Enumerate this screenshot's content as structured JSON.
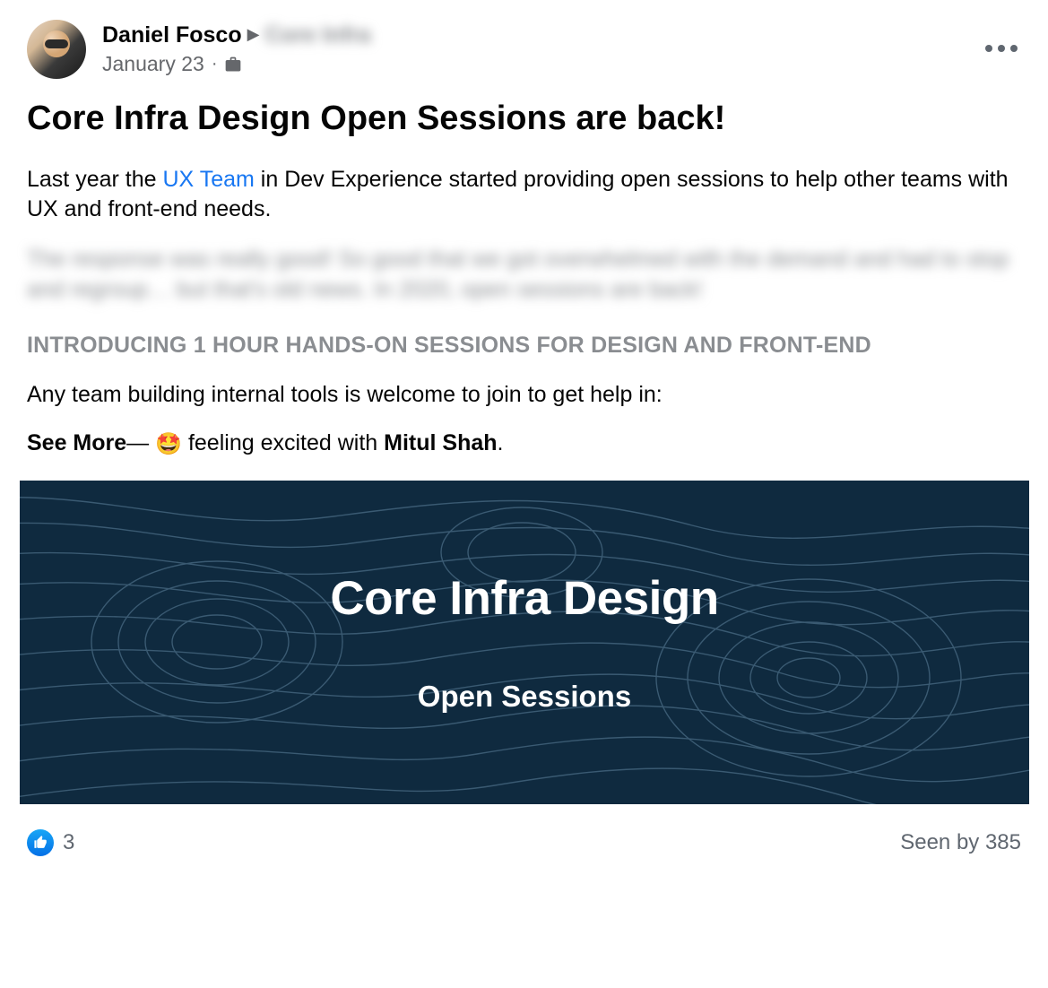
{
  "header": {
    "author_name": "Daniel Fosco",
    "group_name_blurred": "Core Infra",
    "date": "January 23"
  },
  "body": {
    "title": "Core Infra Design Open Sessions are back!",
    "para1_pre": "Last year the ",
    "para1_link": "UX Team",
    "para1_post": " in Dev Experience started providing open sessions to help other teams with UX and front-end needs.",
    "para_blurred": "The response was really good! So good that we got overwhelmed with the demand and had to stop and regroup… but that's old news. In 2020, open sessions are back!",
    "section_heading": "INTRODUCING 1 HOUR HANDS-ON SESSIONS FOR DESIGN AND FRONT-END",
    "para3": "Any team building internal tools is welcome to join to get help in:",
    "see_more": "See More",
    "dash": "— ",
    "feeling_emoji": "🤩",
    "feeling_text": " feeling excited with ",
    "tagged_name": "Mitul Shah",
    "period": "."
  },
  "banner": {
    "title": "Core Infra Design",
    "subtitle": "Open Sessions"
  },
  "footer": {
    "reaction_count": "3",
    "seen_by": "Seen by 385"
  }
}
